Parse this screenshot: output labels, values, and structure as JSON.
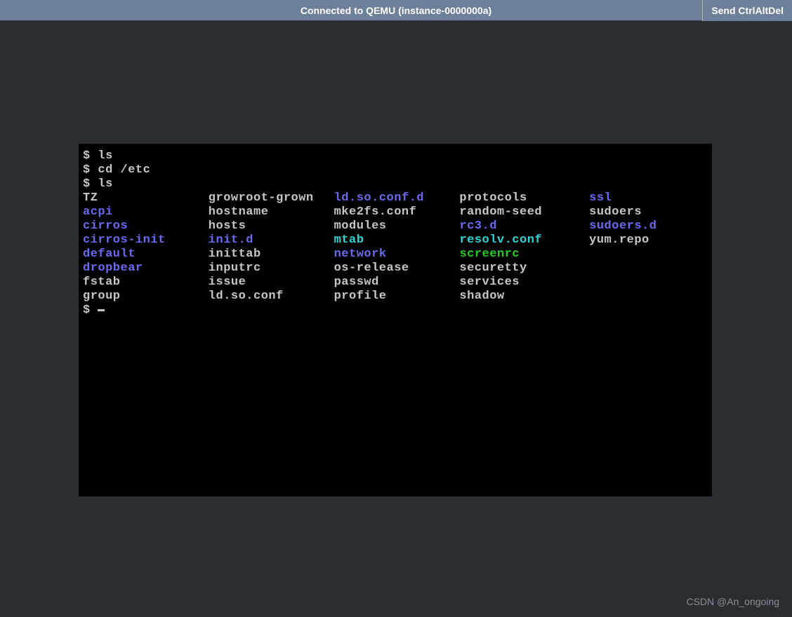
{
  "header": {
    "title": "Connected to QEMU (instance-0000000a)",
    "send_button": "Send CtrlAltDel"
  },
  "terminal": {
    "lines": [
      "$ ls",
      "$ cd /etc",
      "$ ls"
    ],
    "prompt_end": "$ ",
    "listing": [
      [
        {
          "name": "TZ",
          "color": "white"
        },
        {
          "name": "acpi",
          "color": "blue"
        },
        {
          "name": "cirros",
          "color": "blue"
        },
        {
          "name": "cirros-init",
          "color": "blue"
        },
        {
          "name": "default",
          "color": "blue"
        },
        {
          "name": "dropbear",
          "color": "blue"
        },
        {
          "name": "fstab",
          "color": "white"
        },
        {
          "name": "group",
          "color": "white"
        }
      ],
      [
        {
          "name": "growroot-grown",
          "color": "white"
        },
        {
          "name": "hostname",
          "color": "white"
        },
        {
          "name": "hosts",
          "color": "white"
        },
        {
          "name": "init.d",
          "color": "blue"
        },
        {
          "name": "inittab",
          "color": "white"
        },
        {
          "name": "inputrc",
          "color": "white"
        },
        {
          "name": "issue",
          "color": "white"
        },
        {
          "name": "ld.so.conf",
          "color": "white"
        }
      ],
      [
        {
          "name": "ld.so.conf.d",
          "color": "blue"
        },
        {
          "name": "mke2fs.conf",
          "color": "white"
        },
        {
          "name": "modules",
          "color": "white"
        },
        {
          "name": "mtab",
          "color": "cyan"
        },
        {
          "name": "network",
          "color": "blue"
        },
        {
          "name": "os-release",
          "color": "white"
        },
        {
          "name": "passwd",
          "color": "white"
        },
        {
          "name": "profile",
          "color": "white"
        }
      ],
      [
        {
          "name": "protocols",
          "color": "white"
        },
        {
          "name": "random-seed",
          "color": "white"
        },
        {
          "name": "rc3.d",
          "color": "blue"
        },
        {
          "name": "resolv.conf",
          "color": "cyan"
        },
        {
          "name": "screenrc",
          "color": "green"
        },
        {
          "name": "securetty",
          "color": "white"
        },
        {
          "name": "services",
          "color": "white"
        },
        {
          "name": "shadow",
          "color": "white"
        }
      ],
      [
        {
          "name": "ssl",
          "color": "blue"
        },
        {
          "name": "sudoers",
          "color": "white"
        },
        {
          "name": "sudoers.d",
          "color": "blue"
        },
        {
          "name": "yum.repo",
          "color": "white"
        }
      ]
    ]
  },
  "watermark": "CSDN @An_ongoing"
}
